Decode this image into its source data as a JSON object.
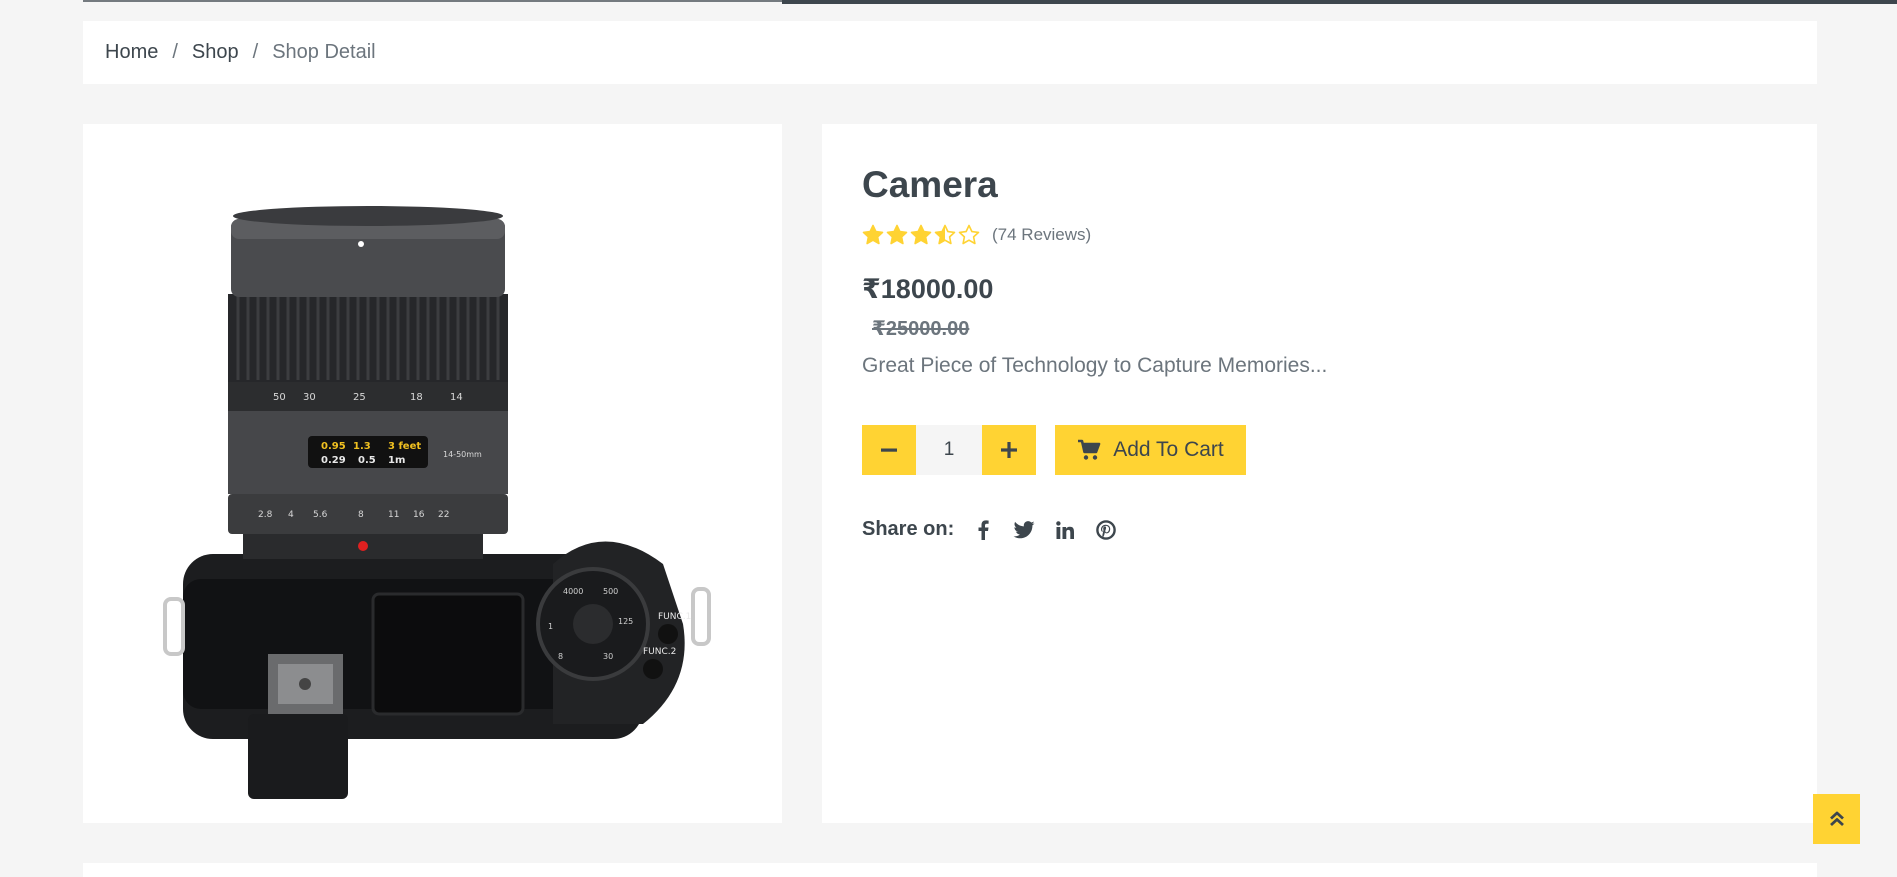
{
  "breadcrumb": {
    "home": "Home",
    "shop": "Shop",
    "current": "Shop Detail",
    "separator": "/"
  },
  "product": {
    "title": "Camera",
    "rating": 3.5,
    "rating_max": 5,
    "reviews": "(74 Reviews)",
    "price": "₹18000.00",
    "old_price": "₹25000.00",
    "description": "Great Piece of Technology to Capture Memories...",
    "quantity": "1",
    "image_icon": "camera-photo"
  },
  "actions": {
    "add_to_cart": "Add To Cart",
    "minus_icon": "minus-icon",
    "plus_icon": "plus-icon",
    "cart_icon": "shopping-cart-icon"
  },
  "share": {
    "label": "Share on:",
    "networks": [
      "facebook",
      "twitter",
      "linkedin",
      "pinterest"
    ]
  },
  "colors": {
    "accent": "#ffd333",
    "dark": "#3d464d",
    "muted": "#6c757d",
    "background": "#f5f5f5"
  }
}
